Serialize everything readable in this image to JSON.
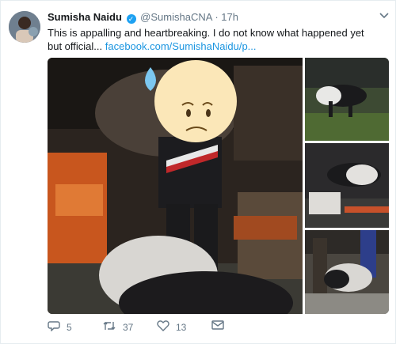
{
  "tweet": {
    "display_name": "Sumisha Naidu",
    "handle": "@SumishaCNA",
    "separator": "·",
    "time": "17h",
    "text": "This is appalling and heartbreaking. I do not know what happened yet but official... ",
    "link": "facebook.com/SumishaNaidu/p..."
  },
  "actions": {
    "reply_count": "5",
    "retweet_count": "37",
    "like_count": "13"
  },
  "icons": {
    "verified": "verified-badge-icon",
    "reply": "reply-icon",
    "retweet": "retweet-icon",
    "like": "heart-icon",
    "dm": "envelope-icon",
    "more": "chevron-down-icon",
    "sweat_emoji": "sweat-smile-emoji"
  },
  "colors": {
    "name": "#14171a",
    "muted": "#657786",
    "link": "#1b95e0",
    "verified": "#1da1f2"
  }
}
